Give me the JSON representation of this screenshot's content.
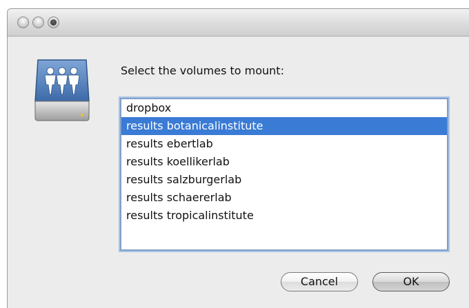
{
  "window": {
    "traffic_lights": [
      "close-button",
      "minimize-button",
      "zoom-button"
    ]
  },
  "dialog": {
    "prompt": "Select the volumes to mount:",
    "icon": "network-share-drive-icon",
    "volumes": [
      {
        "label": "dropbox",
        "selected": false
      },
      {
        "label": "results botanicalinstitute",
        "selected": true
      },
      {
        "label": "results ebertlab",
        "selected": false
      },
      {
        "label": "results koellikerlab",
        "selected": false
      },
      {
        "label": "results salzburgerlab",
        "selected": false
      },
      {
        "label": "results schaererlab",
        "selected": false
      },
      {
        "label": "results tropicalinstitute",
        "selected": false
      }
    ],
    "cancel_label": "Cancel",
    "ok_label": "OK"
  },
  "colors": {
    "selection": "#3a7bd5",
    "list_focus_ring": "#7f9fc8",
    "window_bg": "#ececec"
  }
}
